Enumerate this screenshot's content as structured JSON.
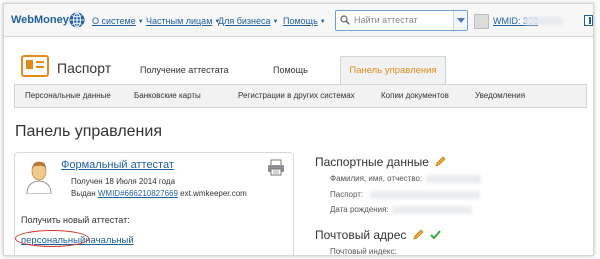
{
  "header": {
    "logo_text": "WebMoney",
    "nav": [
      {
        "label": "О системе"
      },
      {
        "label": "Частным лицам"
      },
      {
        "label": "Для бизнеса"
      },
      {
        "label": "Помощь"
      }
    ],
    "search": {
      "placeholder": "Найти аттестат"
    },
    "wmid_label": "WMID: 308"
  },
  "passport": {
    "title": "Паспорт",
    "tabs": [
      {
        "label": "Получение аттестата"
      },
      {
        "label": "Помощь"
      },
      {
        "label": "Панель управления",
        "active": true
      }
    ],
    "subnav": [
      "Персональные данные",
      "Банковские карты",
      "Регистрации в других системах",
      "Копии документов",
      "Уведомления"
    ]
  },
  "page_title": "Панель управления",
  "attestat_card": {
    "title": "Формальный аттестат",
    "received": "Получен 18 Июля 2014 года",
    "issued_prefix": "Выдан",
    "issuer_wmid": "WMID#666210827669",
    "issuer_name": "ext.wmkeeper.com",
    "get_new_label": "Получить новый аттестат:",
    "options": [
      "персональный",
      "начальный"
    ]
  },
  "passport_data": {
    "title": "Паспортные данные",
    "fields": [
      "Фамилия, имя, отчество:",
      "Паспорт:",
      "Дата рождения:"
    ]
  },
  "postal": {
    "title": "Почтовый адрес",
    "fields": [
      "Почтовый индекс:"
    ]
  },
  "colors": {
    "link": "#1f5f9c",
    "active_tab": "#e28b1a",
    "highlight_oval": "#d23a2a"
  }
}
